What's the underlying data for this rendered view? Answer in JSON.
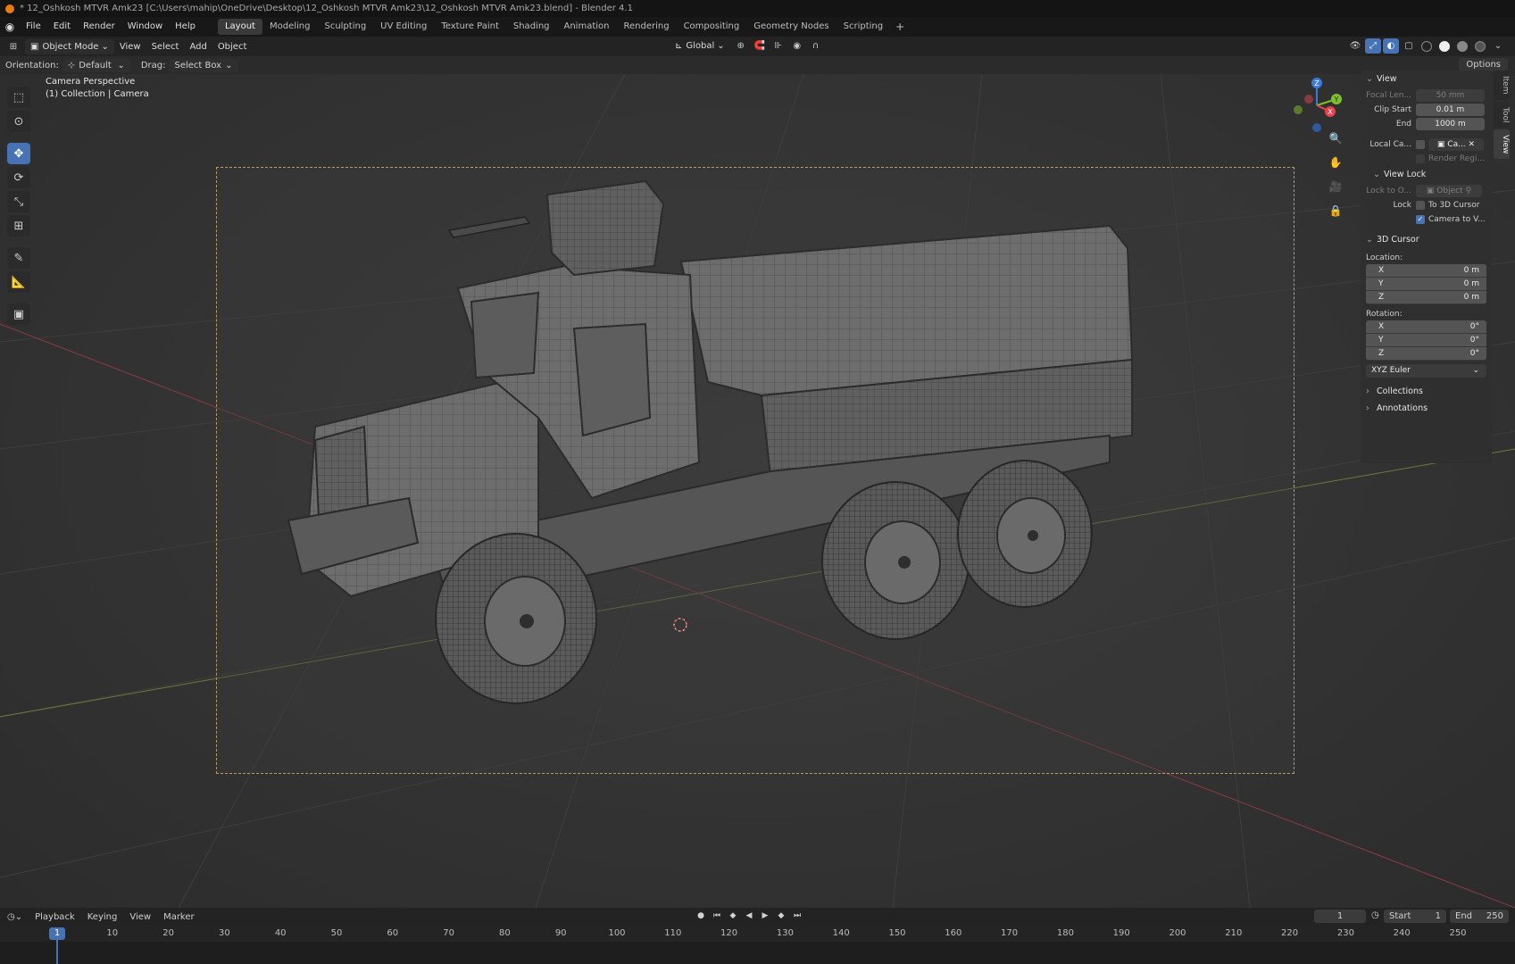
{
  "window": {
    "title": "* 12_Oshkosh MTVR Amk23 [C:\\Users\\mahip\\OneDrive\\Desktop\\12_Oshkosh MTVR Amk23\\12_Oshkosh MTVR Amk23.blend] - Blender 4.1"
  },
  "menu": {
    "items": [
      "File",
      "Edit",
      "Render",
      "Window",
      "Help"
    ],
    "workspaces": [
      "Layout",
      "Modeling",
      "Sculpting",
      "UV Editing",
      "Texture Paint",
      "Shading",
      "Animation",
      "Rendering",
      "Compositing",
      "Geometry Nodes",
      "Scripting"
    ],
    "active_workspace": "Layout"
  },
  "header": {
    "mode": "Object Mode",
    "menus": [
      "View",
      "Select",
      "Add",
      "Object"
    ],
    "transform_orientation": "Global"
  },
  "toolsettings": {
    "orientation_label": "Orientation:",
    "orientation_value": "Default",
    "drag_label": "Drag:",
    "drag_value": "Select Box",
    "options": "Options"
  },
  "viewport": {
    "perspective": "Camera Perspective",
    "collection": "(1) Collection | Camera"
  },
  "npanel": {
    "view_header": "View",
    "focal_label": "Focal Len...",
    "focal_value": "50 mm",
    "clip_start_label": "Clip Start",
    "clip_start_value": "0.01 m",
    "end_label": "End",
    "end_value": "1000 m",
    "local_cam_label": "Local Ca...",
    "local_cam_value": "Ca...",
    "render_region": "Render Regi...",
    "view_lock_header": "View Lock",
    "lock_to_label": "Lock to O...",
    "lock_to_value": "Object",
    "lock_label": "Lock",
    "to_3d_cursor": "To 3D Cursor",
    "camera_to_view": "Camera to V...",
    "cursor_header": "3D Cursor",
    "location_label": "Location:",
    "location": [
      {
        "axis": "X",
        "value": "0 m"
      },
      {
        "axis": "Y",
        "value": "0 m"
      },
      {
        "axis": "Z",
        "value": "0 m"
      }
    ],
    "rotation_label": "Rotation:",
    "rotation": [
      {
        "axis": "X",
        "value": "0°"
      },
      {
        "axis": "Y",
        "value": "0°"
      },
      {
        "axis": "Z",
        "value": "0°"
      }
    ],
    "rotation_mode": "XYZ Euler",
    "collections": "Collections",
    "annotations": "Annotations",
    "tabs": [
      "Item",
      "Tool",
      "View"
    ],
    "active_tab": "View"
  },
  "timeline": {
    "menus": [
      "Playback",
      "Keying",
      "View",
      "Marker"
    ],
    "current_frame": "1",
    "start_label": "Start",
    "start_value": "1",
    "end_label": "End",
    "end_value": "250",
    "ticks": [
      "10",
      "20",
      "30",
      "40",
      "50",
      "60",
      "70",
      "80",
      "90",
      "100",
      "110",
      "120",
      "130",
      "140",
      "150",
      "160",
      "170",
      "180",
      "190",
      "200",
      "210",
      "220",
      "230",
      "240",
      "250"
    ],
    "playhead": "1"
  },
  "colors": {
    "accent": "#4772b3",
    "axis_x": "#e8424e",
    "axis_y": "#7fbf2a",
    "axis_z": "#3d7bd8"
  }
}
